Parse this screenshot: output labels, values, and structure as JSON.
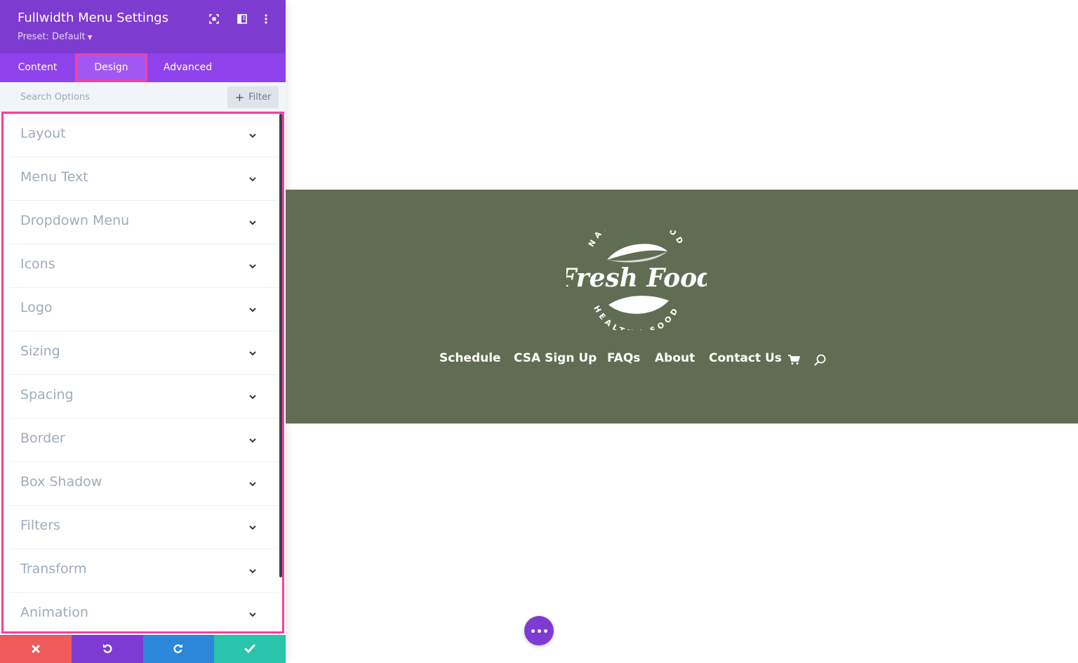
{
  "panel": {
    "title": "Fullwidth Menu Settings",
    "preset": "Preset: Default",
    "tabs": [
      {
        "label": "Content"
      },
      {
        "label": "Design"
      },
      {
        "label": "Advanced"
      }
    ],
    "active_tab": "Design",
    "search": {
      "placeholder": "Search Options",
      "value": ""
    },
    "filter_label": "Filter",
    "options": [
      {
        "label": "Layout"
      },
      {
        "label": "Menu Text"
      },
      {
        "label": "Dropdown Menu"
      },
      {
        "label": "Icons"
      },
      {
        "label": "Logo"
      },
      {
        "label": "Sizing"
      },
      {
        "label": "Spacing"
      },
      {
        "label": "Border"
      },
      {
        "label": "Box Shadow"
      },
      {
        "label": "Filters"
      },
      {
        "label": "Transform"
      },
      {
        "label": "Animation"
      }
    ],
    "header_icons": [
      "fullscreen-icon",
      "split-view-icon",
      "more-vertical-icon"
    ],
    "footer_icons": [
      "close-icon",
      "undo-icon",
      "redo-icon",
      "check-icon"
    ]
  },
  "preview": {
    "logo": {
      "top_arc": "NATURAL FOOD",
      "wordmark": "Fresh Food",
      "bottom_arc": "HEALTHY FOOD"
    },
    "menu": [
      {
        "label": "Schedule"
      },
      {
        "label": "CSA Sign Up"
      },
      {
        "label": "FAQs"
      },
      {
        "label": "About"
      },
      {
        "label": "Contact Us"
      }
    ],
    "menu_icons": [
      "cart-icon",
      "search-icon"
    ]
  },
  "colors": {
    "header_purple": "#7e3bd0",
    "tabs_purple": "#8f42ec",
    "highlight_pink": "#f0439b",
    "hero_green": "#616d52",
    "close_red": "#ef5a5a",
    "redo_blue": "#2b87da",
    "save_green": "#29c4a9"
  }
}
